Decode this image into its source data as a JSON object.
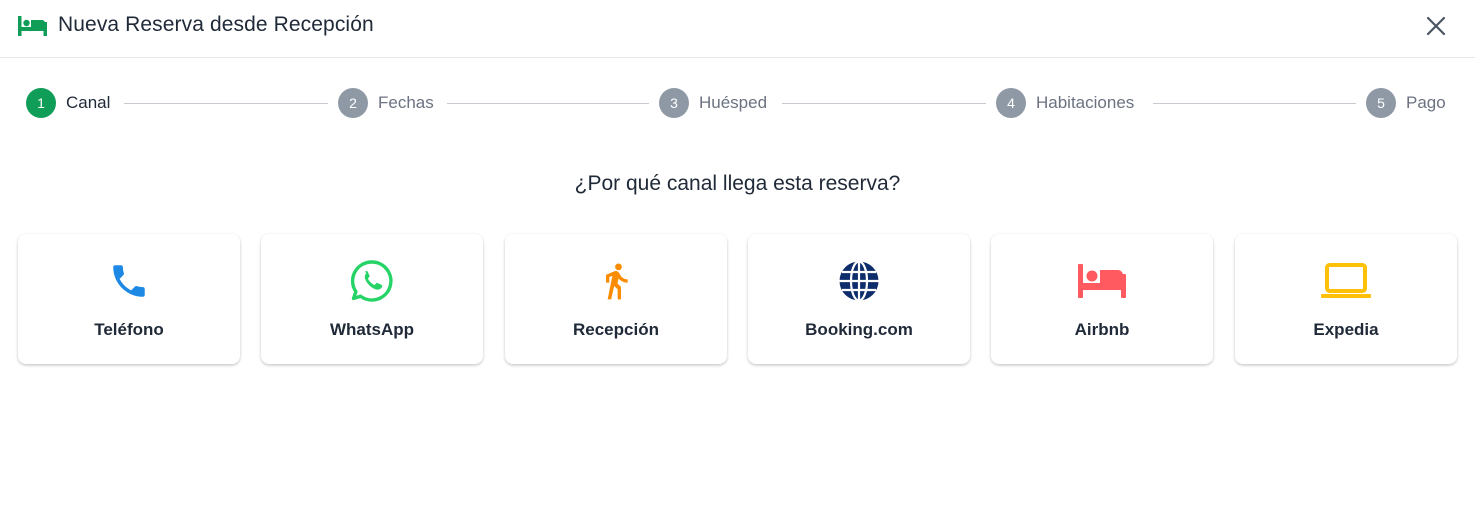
{
  "header": {
    "title": "Nueva Reserva desde Recepción",
    "icon": "bed-icon",
    "close_icon": "close-icon"
  },
  "stepper": {
    "active_step": 1,
    "steps": [
      {
        "number": "1",
        "label": "Canal"
      },
      {
        "number": "2",
        "label": "Fechas"
      },
      {
        "number": "3",
        "label": "Huésped"
      },
      {
        "number": "4",
        "label": "Habitaciones"
      },
      {
        "number": "5",
        "label": "Pago"
      }
    ]
  },
  "question": "¿Por qué canal llega esta reserva?",
  "channels": [
    {
      "label": "Teléfono",
      "icon": "phone-icon",
      "color": "#1e88e5"
    },
    {
      "label": "WhatsApp",
      "icon": "whatsapp-icon",
      "color": "#25d366"
    },
    {
      "label": "Recepción",
      "icon": "walking-person-icon",
      "color": "#fb8c00"
    },
    {
      "label": "Booking.com",
      "icon": "globe-icon",
      "color": "#0d2d6b"
    },
    {
      "label": "Airbnb",
      "icon": "bed-icon",
      "color": "#ff5a5f"
    },
    {
      "label": "Expedia",
      "icon": "laptop-icon",
      "color": "#ffc107"
    }
  ],
  "colors": {
    "accent": "#0f9d58",
    "step_inactive": "#8f99a5"
  }
}
